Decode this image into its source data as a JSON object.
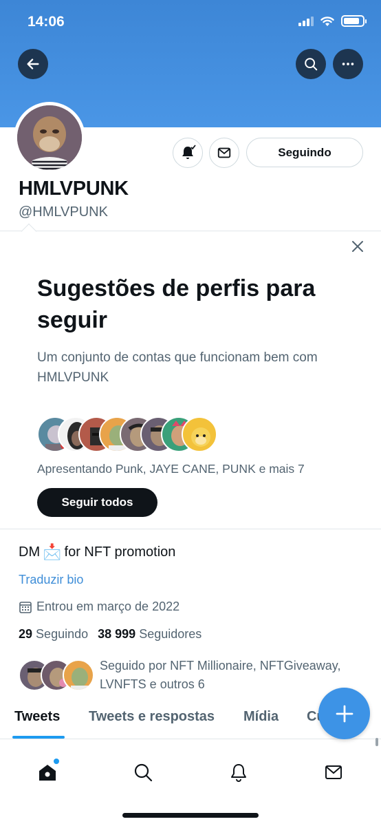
{
  "status_bar": {
    "time": "14:06"
  },
  "header": {
    "back_icon": "arrow-left-icon",
    "search_icon": "search-icon",
    "more_icon": "more-horizontal-icon"
  },
  "profile": {
    "display_name": "HMLVPUNK",
    "handle": "@HMLVPUNK",
    "following_button": "Seguindo",
    "notifications_icon": "bell-check-icon",
    "message_icon": "envelope-icon"
  },
  "suggestions": {
    "title": "Sugestões de perfis para seguir",
    "subtitle": "Um conjunto de contas que funcionam bem com HMLVPUNK",
    "featuring": "Apresentando Punk, JAYE CANE, PUNK e mais 7",
    "follow_all_button": "Seguir todos",
    "close_icon": "close-icon"
  },
  "bio": {
    "text_before": "DM",
    "emoji": "📩",
    "text_after": "for NFT promotion",
    "translate_link": "Traduzir bio",
    "joined": "Entrou em março de 2022",
    "following_count": "29",
    "following_label": "Seguindo",
    "followers_count": "38 999",
    "followers_label": "Seguidores",
    "followed_by": "Seguido por NFT Millionaire, NFTGiveaway, LVNFTS e outros 6"
  },
  "tabs": [
    {
      "label": "Tweets",
      "active": true
    },
    {
      "label": "Tweets e respostas",
      "active": false
    },
    {
      "label": "Mídia",
      "active": false
    },
    {
      "label": "Curtidas",
      "active": false
    }
  ],
  "compose_icon": "plus-icon",
  "bottom_nav": [
    "home-icon",
    "search-icon",
    "bell-icon",
    "envelope-icon"
  ],
  "colors": {
    "banner": "#4a96e6",
    "accent": "#1d9bf0",
    "link": "#3f8ed8",
    "dark_button": "#0f1419"
  }
}
